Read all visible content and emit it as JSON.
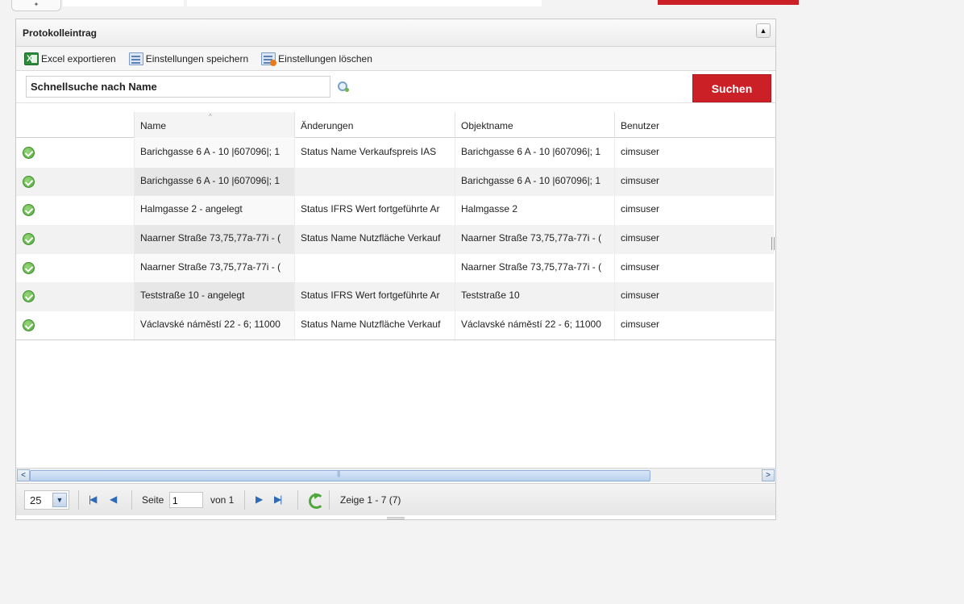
{
  "panel": {
    "title": "Protokolleintrag",
    "collapse_glyph": "▲"
  },
  "toolbar": {
    "export_label": "Excel exportieren",
    "save_label": "Einstellungen speichern",
    "delete_label": "Einstellungen löschen"
  },
  "search": {
    "value": "Schnellsuche nach Name",
    "button_label": "Suchen"
  },
  "grid": {
    "columns": [
      "",
      "Name",
      "Änderungen",
      "Objektname",
      "Benutzer"
    ],
    "sort_indicator": "^",
    "rows": [
      {
        "status_icon": "check-circle-icon",
        "name": "Barichgasse 6 A - 10 |607096|; 1",
        "changes": "Status Name Verkaufspreis IAS",
        "object": "Barichgasse 6 A - 10 |607096|; 1",
        "user": "cimsuser"
      },
      {
        "status_icon": "check-circle-icon",
        "name": "Barichgasse 6 A - 10 |607096|; 1",
        "changes": "",
        "object": "Barichgasse 6 A - 10 |607096|; 1",
        "user": "cimsuser"
      },
      {
        "status_icon": "check-circle-icon",
        "name": "Halmgasse 2 - angelegt",
        "changes": "Status IFRS Wert fortgeführte Ar",
        "object": "Halmgasse 2",
        "user": "cimsuser"
      },
      {
        "status_icon": "check-circle-icon",
        "name": "Naarner Straße 73,75,77a-77i - (",
        "changes": "Status Name Nutzfläche Verkauf",
        "object": "Naarner Straße 73,75,77a-77i - (",
        "user": "cimsuser"
      },
      {
        "status_icon": "check-circle-icon",
        "name": "Naarner Straße 73,75,77a-77i - (",
        "changes": "",
        "object": "Naarner Straße 73,75,77a-77i - (",
        "user": "cimsuser"
      },
      {
        "status_icon": "check-circle-icon",
        "name": "Teststraße 10 - angelegt",
        "changes": "Status IFRS Wert fortgeführte Ar",
        "object": "Teststraße 10",
        "user": "cimsuser"
      },
      {
        "status_icon": "check-circle-icon",
        "name": "Václavské náměstí 22 - 6; 11000",
        "changes": "Status Name Nutzfläche Verkauf",
        "object": "Václavské náměstí 22 - 6; 11000",
        "user": "cimsuser"
      }
    ]
  },
  "scrollbar": {
    "left_arrow": "<",
    "right_arrow": ">"
  },
  "pager": {
    "page_size": "25",
    "page_label": "Seite",
    "page_value": "1",
    "of_label": "von 1",
    "summary": "Zeige 1 - 7 (7)",
    "first_glyph": "|◀",
    "prev_glyph": "◀",
    "next_glyph": "▶",
    "last_glyph": "▶|"
  },
  "colors": {
    "accent_red": "#cc2027",
    "ok_green": "#4da93a",
    "link_blue": "#2f6bb5"
  }
}
